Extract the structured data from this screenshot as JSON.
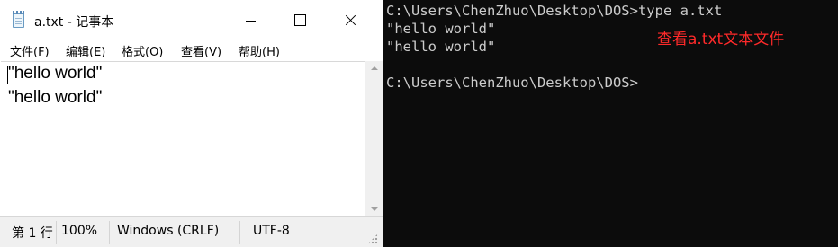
{
  "notepad": {
    "title": "a.txt - 记事本",
    "menu": [
      "文件(F)",
      "编辑(E)",
      "格式(O)",
      "查看(V)",
      "帮助(H)"
    ],
    "lines": [
      "\"hello world\"",
      "\"hello world\""
    ],
    "status": {
      "position": "第 1 行",
      "zoom": "100%",
      "line_ending": "Windows (CRLF)",
      "encoding": "UTF-8"
    },
    "icons": {
      "app": "notepad-icon",
      "minimize": "minimize-icon",
      "maximize": "maximize-icon",
      "close": "close-icon"
    }
  },
  "console": {
    "lines": [
      "C:\\Users\\ChenZhuo\\Desktop\\DOS>type a.txt",
      "\"hello world\"",
      "\"hello world\"",
      "C:\\Users\\ChenZhuo\\Desktop\\DOS>"
    ],
    "annotation": "查看a.txt文本文件",
    "colors": {
      "background": "#0c0c0c",
      "text": "#cccccc",
      "annotation": "#ff2a2a"
    }
  }
}
